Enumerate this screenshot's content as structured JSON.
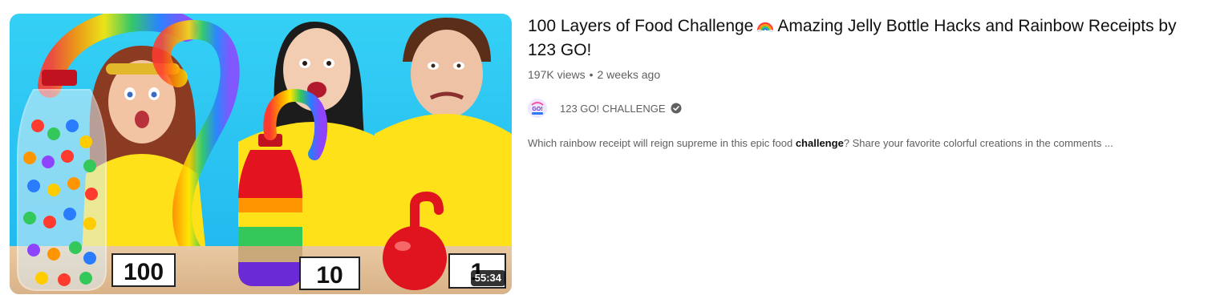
{
  "video": {
    "title_part1": "100 Layers of Food Challenge",
    "title_emoji": "rainbow-emoji",
    "title_part2": "Amazing Jelly Bottle Hacks and Rainbow Receipts by 123 GO!",
    "views": "197K views",
    "separator": "•",
    "age": "2 weeks ago",
    "duration": "55:34",
    "channel": {
      "name": "123 GO! CHALLENGE",
      "avatar_icon": "channel-logo-icon",
      "verified_icon": "verified-check-icon"
    },
    "description": {
      "before": "Which rainbow receipt will reign supreme in this epic food ",
      "bold": "challenge",
      "after": "? Share your favorite colorful creations in the comments ..."
    },
    "thumbnail": {
      "sign_left": "100",
      "sign_middle": "10",
      "sign_right": "1"
    }
  },
  "colors": {
    "title": "#0f0f0f",
    "secondary": "#606060",
    "background": "#ffffff",
    "thumbnail_sky": "#2fc4f2",
    "shirt": "#ffe11a"
  }
}
